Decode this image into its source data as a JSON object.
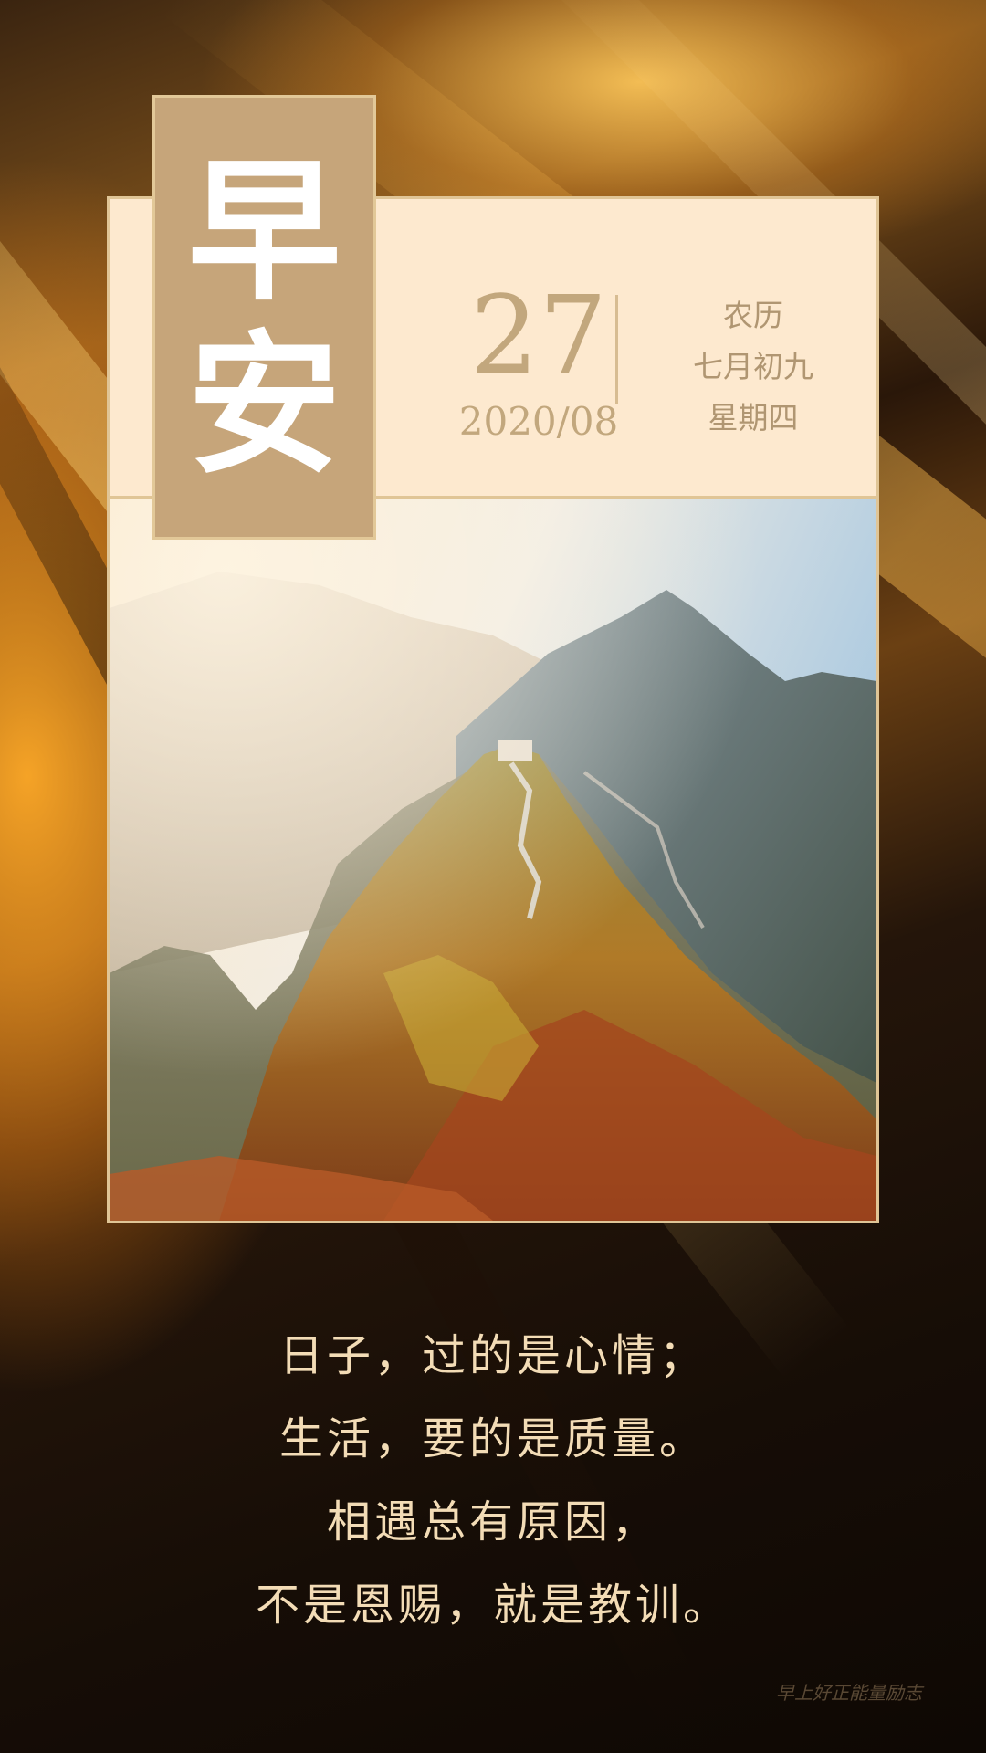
{
  "title": {
    "line1": "早",
    "line2": "安"
  },
  "date": {
    "day": "27",
    "year_month": "2020/08"
  },
  "lunar": {
    "line1": "农历",
    "line2": "七月初九",
    "line3": "星期四"
  },
  "quote": {
    "lines": [
      "日子，过的是心情；",
      "生活，要的是质量。",
      "相遇总有原因，",
      "不是恩赐，就是教训。"
    ]
  },
  "watermark": "早上好正能量励志",
  "colors": {
    "accent_gold": "#c6a57a",
    "panel": "#fde9cf",
    "quote_text": "#f3dcb6"
  }
}
